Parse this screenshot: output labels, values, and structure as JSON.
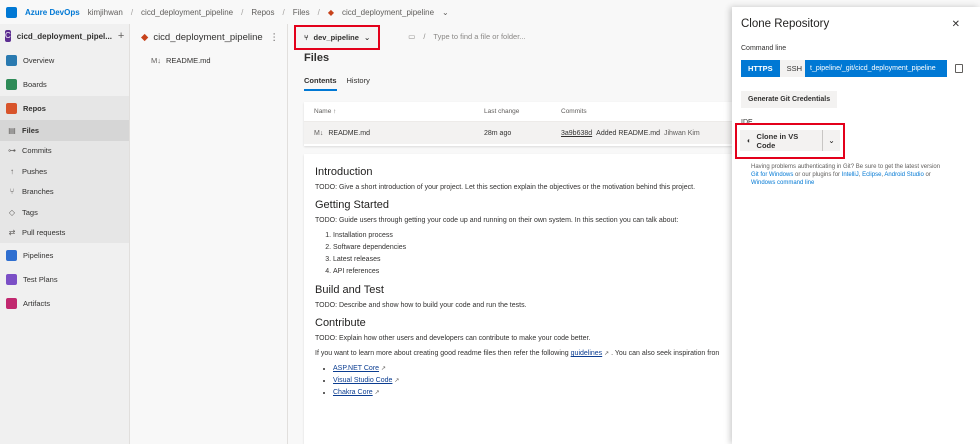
{
  "topbar": {
    "brand": "Azure DevOps",
    "org": "kimjihwan",
    "crumbs": [
      "cicd_deployment_pipeline",
      "Repos",
      "Files",
      "cicd_deployment_pipeline"
    ]
  },
  "sidebar": {
    "project_initial": "C",
    "project_name": "cicd_deployment_pipel...",
    "items": [
      {
        "label": "Overview",
        "color": "#2a7ab0"
      },
      {
        "label": "Boards",
        "color": "#2e8b57"
      },
      {
        "label": "Repos",
        "color": "#d8542b"
      },
      {
        "label": "Pipelines",
        "color": "#2f6fd0"
      },
      {
        "label": "Test Plans",
        "color": "#7b4fc6"
      },
      {
        "label": "Artifacts",
        "color": "#c1286f"
      }
    ],
    "repos_sub": [
      "Files",
      "Commits",
      "Pushes",
      "Branches",
      "Tags",
      "Pull requests"
    ]
  },
  "tree": {
    "repo": "cicd_deployment_pipeline",
    "file": "README.md"
  },
  "main": {
    "branch": "dev_pipeline",
    "file_search_placeholder": "Type to find a file or folder...",
    "title": "Files",
    "tabs": [
      "Contents",
      "History"
    ],
    "columns": [
      "Name ↑",
      "Last change",
      "Commits"
    ],
    "row": {
      "name": "README.md",
      "last_change": "28m ago",
      "hash": "3a9b638d",
      "message": "Added README.md",
      "author": "Jihwan Kim"
    }
  },
  "readme": {
    "h_intro": "Introduction",
    "p_intro": "TODO: Give a short introduction of your project. Let this section explain the objectives or the motivation behind this project.",
    "h_start": "Getting Started",
    "p_start": "TODO: Guide users through getting your code up and running on their own system. In this section you can talk about:",
    "start_list": [
      "Installation process",
      "Software dependencies",
      "Latest releases",
      "API references"
    ],
    "h_build": "Build and Test",
    "p_build": "TODO: Describe and show how to build your code and run the tests.",
    "h_contrib": "Contribute",
    "p_contrib": "TODO: Explain how other users and developers can contribute to make your code better.",
    "p_more_a": "If you want to learn more about creating good readme files then refer the following",
    "p_more_link": "guidelines",
    "p_more_b": ". You can also seek inspiration fron",
    "links": [
      "ASP.NET Core",
      "Visual Studio Code",
      "Chakra Core"
    ]
  },
  "clone": {
    "title": "Clone Repository",
    "cmd_label": "Command line",
    "https": "HTTPS",
    "ssh": "SSH",
    "url": "t_pipeline/_git/cicd_deployment_pipeline",
    "gen_label": "Generate Git Credentials",
    "ide_label": "IDE",
    "vs_label": "Clone in VS Code",
    "help_a": "Having problems authenticating in Git? Be sure to get the latest version",
    "help_link1": "Git for Windows",
    "help_b": " or our plugins for ",
    "help_link2": "IntelliJ",
    "help_c": ", ",
    "help_link3": "Eclipse",
    "help_d": ", ",
    "help_link4": "Android Studio",
    "help_e": " or",
    "help_link5": "Windows command line"
  }
}
